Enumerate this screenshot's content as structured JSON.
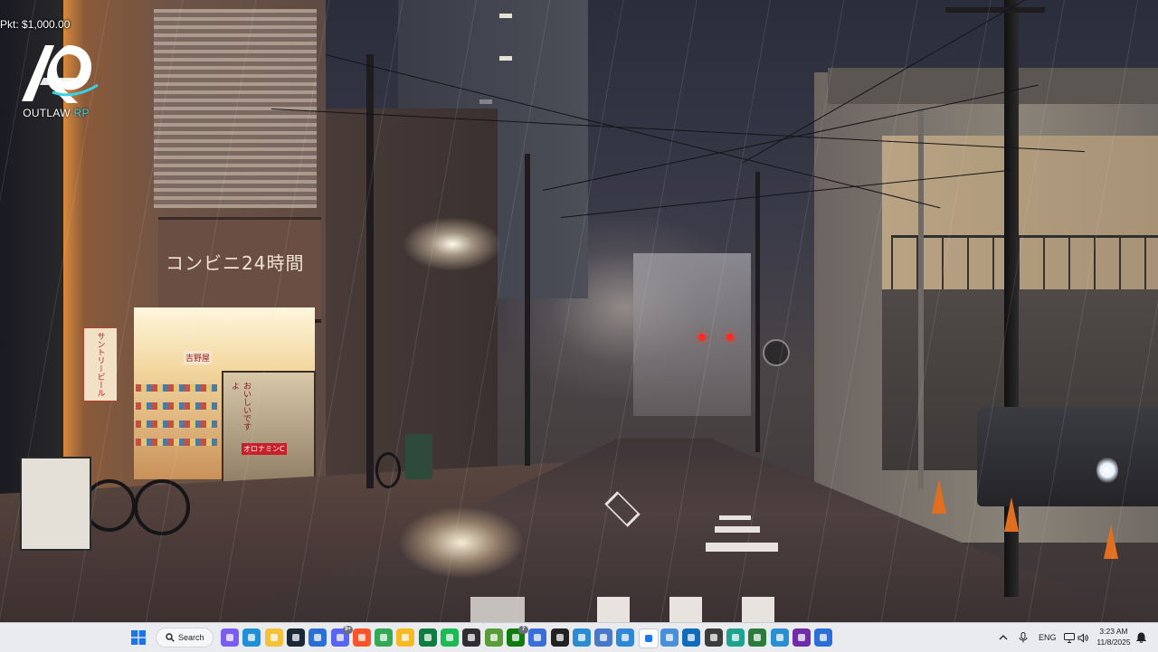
{
  "hud": {
    "money": "Pkt: $1,000.00",
    "logo_word": "OUTLAW",
    "logo_rp": "RP"
  },
  "wallpaper": {
    "sign_main": "コンビニ24時間",
    "sign_side": "サントリービール",
    "vending_text": "おいしいですよ",
    "vending_brand": "オロナミンC",
    "shop_door": "吉野屋"
  },
  "taskbar": {
    "start_icon": "windows-start-icon",
    "search_label": "Search",
    "apps": [
      {
        "name": "copilot-icon",
        "color": "#7b5cf0"
      },
      {
        "name": "edge-icon",
        "color": "#1f8fd6"
      },
      {
        "name": "file-explorer-icon",
        "color": "#f3c13a"
      },
      {
        "name": "steam-icon",
        "color": "#1b2838"
      },
      {
        "name": "microsoft-store-icon",
        "color": "#2b6fd6"
      },
      {
        "name": "discord-icon",
        "color": "#5865f2",
        "badge": "9+"
      },
      {
        "name": "brave-icon",
        "color": "#fb542b"
      },
      {
        "name": "chrome-icon",
        "color": "#34a853"
      },
      {
        "name": "messenger-icon",
        "color": "#f5b921"
      },
      {
        "name": "excel-icon",
        "color": "#107c41"
      },
      {
        "name": "spotify-icon",
        "color": "#1db954"
      },
      {
        "name": "obs-icon",
        "color": "#302e31"
      },
      {
        "name": "minecraft-icon",
        "color": "#5a9c3a"
      },
      {
        "name": "xbox-icon",
        "color": "#107c10",
        "badge": "7"
      },
      {
        "name": "gamepad-icon",
        "color": "#3a6fd8"
      },
      {
        "name": "davinci-resolve-icon",
        "color": "#222222"
      },
      {
        "name": "globe-app-icon",
        "color": "#2c8bd1"
      },
      {
        "name": "ring-app-icon",
        "color": "#4a78c9"
      },
      {
        "name": "fox-app-icon",
        "color": "#2e88d6"
      },
      {
        "name": "meta-icon",
        "color": "#ffffff"
      },
      {
        "name": "m-app-icon",
        "color": "#4a90d9"
      },
      {
        "name": "outlook-icon",
        "color": "#0f6cbd"
      },
      {
        "name": "bm-app-icon",
        "color": "#3c3c3c"
      },
      {
        "name": "teal-app-icon",
        "color": "#1fa391"
      },
      {
        "name": "nb-app-icon",
        "color": "#2c7a3e"
      },
      {
        "name": "photos-icon",
        "color": "#2a8fd0"
      },
      {
        "name": "next-app-icon",
        "color": "#6f2da8"
      },
      {
        "name": "blue-app-icon",
        "color": "#2b6fd6"
      }
    ],
    "tray": {
      "chevron_icon": "chevron-up-icon",
      "mic_icon": "microphone-icon",
      "language": "ENG",
      "network_icon": "network-icon",
      "volume_icon": "volume-icon",
      "time": "3:23 AM",
      "date": "11/8/2025",
      "notification_icon": "notification-icon"
    }
  }
}
